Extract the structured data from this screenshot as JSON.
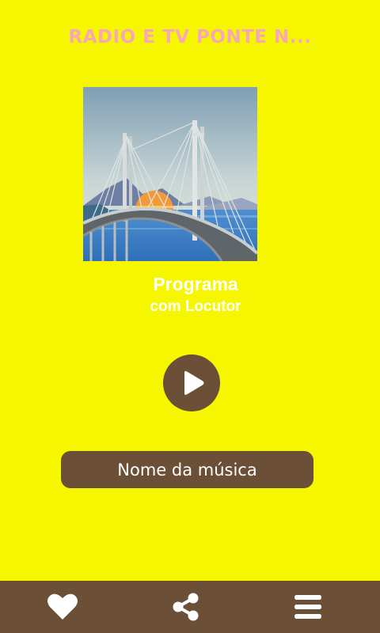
{
  "app": {
    "title": "RADIO E TV PONTE N...",
    "program_line1": "Programa",
    "program_line2": "com Locutor",
    "song_name": "Nome da música"
  },
  "icons": {
    "cover": "bridge-artwork-image",
    "play": "play-icon",
    "favorite": "heart-icon",
    "share": "share-icon",
    "menu": "hamburger-menu-icon"
  },
  "colors": {
    "background": "#f6f600",
    "title": "#f7a8b8",
    "accent_brown": "#6b4f37",
    "text_light": "#ffffff"
  }
}
